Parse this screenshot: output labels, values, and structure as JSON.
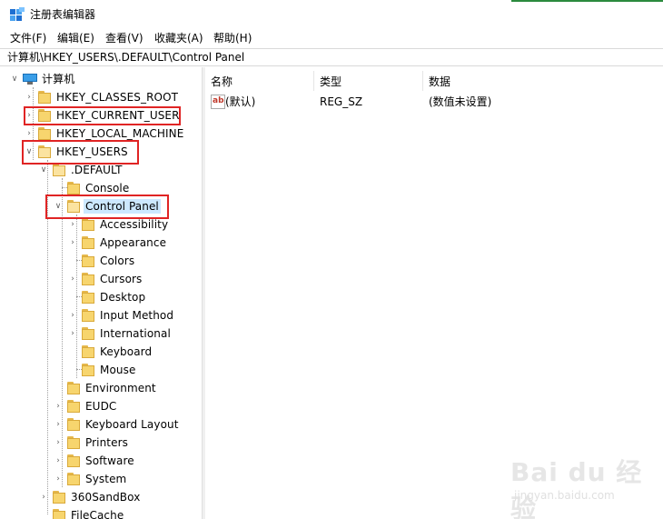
{
  "window": {
    "title": "注册表编辑器"
  },
  "menu": [
    "文件(F)",
    "编辑(E)",
    "查看(V)",
    "收藏夹(A)",
    "帮助(H)"
  ],
  "address": "计算机\\HKEY_USERS\\.DEFAULT\\Control Panel",
  "tree": {
    "root": "计算机",
    "hives": [
      "HKEY_CLASSES_ROOT",
      "HKEY_CURRENT_USER",
      "HKEY_LOCAL_MACHINE",
      "HKEY_USERS"
    ],
    "default_key": ".DEFAULT",
    "default_children_before": [
      "Console"
    ],
    "selected": "Control Panel",
    "control_panel_children": [
      "Accessibility",
      "Appearance",
      "Colors",
      "Cursors",
      "Desktop",
      "Input Method",
      "International",
      "Keyboard",
      "Mouse"
    ],
    "default_children_after": [
      "Environment",
      "EUDC",
      "Keyboard Layout",
      "Printers",
      "Software",
      "System"
    ],
    "users_children_after": [
      "360SandBox",
      "FileCache"
    ]
  },
  "list": {
    "headers": [
      "名称",
      "类型",
      "数据"
    ],
    "rows": [
      {
        "name": "(默认)",
        "type": "REG_SZ",
        "data": "(数值未设置)"
      }
    ]
  },
  "watermark": {
    "text": "Bai du 经验",
    "sub": "jingyan.baidu.com"
  }
}
